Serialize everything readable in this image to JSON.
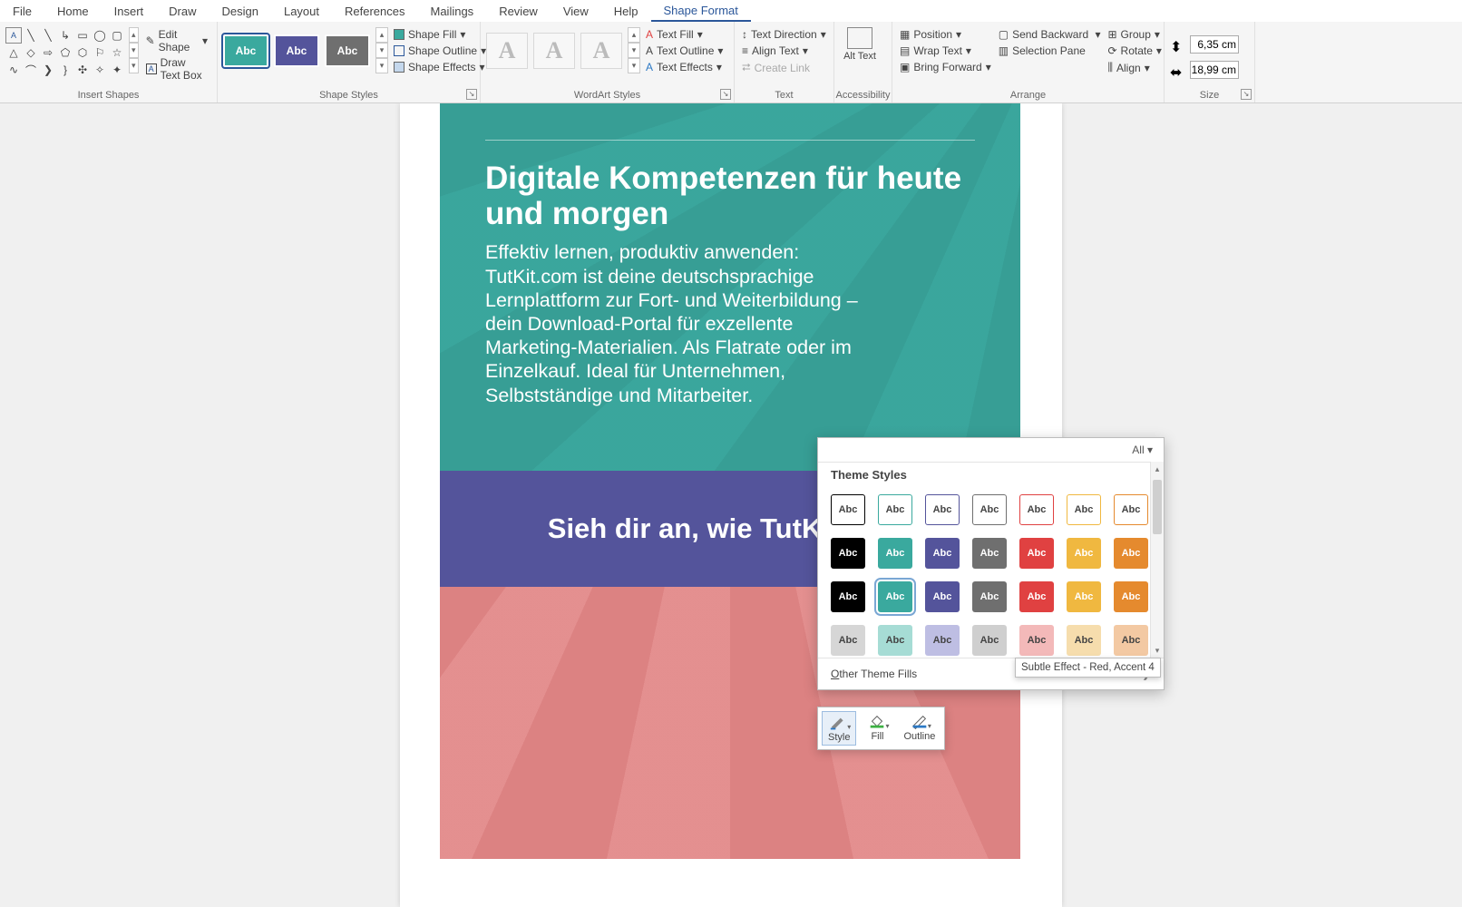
{
  "menu_tabs": [
    "File",
    "Home",
    "Insert",
    "Draw",
    "Design",
    "Layout",
    "References",
    "Mailings",
    "Review",
    "View",
    "Help",
    "Shape Format"
  ],
  "active_tab": "Shape Format",
  "groups": {
    "insert_shapes": {
      "label": "Insert Shapes",
      "edit_shape": "Edit Shape",
      "draw_textbox": "Draw Text Box"
    },
    "shape_styles": {
      "label": "Shape Styles",
      "fill": "Shape Fill",
      "outline": "Shape Outline",
      "effects": "Shape Effects"
    },
    "wordart": {
      "label": "WordArt Styles",
      "fill": "Text Fill",
      "outline": "Text Outline",
      "effects": "Text Effects"
    },
    "text": {
      "label": "Text",
      "direction": "Text Direction",
      "align": "Align Text",
      "link": "Create Link"
    },
    "accessibility": {
      "label": "Accessibility",
      "alt": "Alt Text"
    },
    "arrange": {
      "label": "Arrange",
      "position": "Position",
      "wrap": "Wrap Text",
      "forward": "Bring Forward",
      "backward": "Send Backward",
      "selection": "Selection Pane",
      "group": "Group",
      "rotate": "Rotate",
      "align": "Align"
    },
    "size": {
      "label": "Size",
      "height": "6,35 cm",
      "width": "18,99 cm"
    }
  },
  "shape_style_swatches": [
    {
      "bg": "#3aa99e",
      "sel": true
    },
    {
      "bg": "#54549b",
      "sel": false
    },
    {
      "bg": "#6f6f6f",
      "sel": false
    }
  ],
  "doc": {
    "heading": "Digitale Kompetenzen für heute und morgen",
    "body": "Effektiv lernen, produktiv anwenden: TutKit.com ist deine deutschsprachige Lernplattform zur Fort- und Weiterbildung – dein Download-Portal für exzellente Marketing-Materialien. Als Flatrate oder im Einzelkauf. Ideal für Unternehmen, Selbstständige und Mitarbeiter.",
    "sub": "Sieh dir an, wie TutKit dir w"
  },
  "popup": {
    "all": "All",
    "header": "Theme Styles",
    "other": "Other Theme Fills",
    "tooltip": "Subtle Effect - Red, Accent 4",
    "colors": [
      "#000000",
      "#3aa99e",
      "#54549b",
      "#6f6f6f",
      "#e04141",
      "#f0b840",
      "#e58a2e"
    ],
    "soft_colors": [
      "#d6d6d6",
      "#a6dcd5",
      "#bebee3",
      "#cfcfcf",
      "#f3b9b9",
      "#f6ddad",
      "#f3c9a3"
    ]
  },
  "minibar": {
    "style": "Style",
    "fill": "Fill",
    "outline": "Outline"
  }
}
